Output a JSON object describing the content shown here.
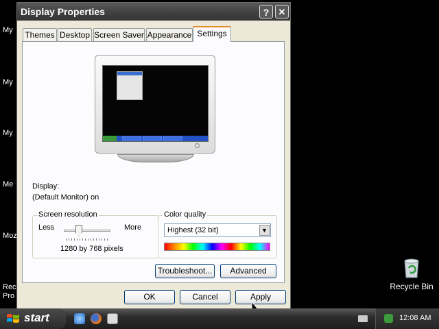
{
  "desktop": {
    "left_labels": [
      "My",
      "My",
      "My",
      "Me",
      "Moz",
      "Rec",
      "Pro"
    ],
    "recycle_bin_label": "Recycle Bin"
  },
  "window": {
    "title": "Display Properties",
    "help_label": "?",
    "close_label": "✕",
    "tabs": [
      {
        "label": "Themes"
      },
      {
        "label": "Desktop"
      },
      {
        "label": "Screen Saver"
      },
      {
        "label": "Appearance"
      },
      {
        "label": "Settings",
        "active": true
      }
    ],
    "settings": {
      "display_label": "Display:",
      "display_value": "(Default Monitor) on",
      "resolution": {
        "group_label": "Screen resolution",
        "less_label": "Less",
        "more_label": "More",
        "value_text": "1280 by 768 pixels",
        "slider_level": 0.3
      },
      "color_quality": {
        "group_label": "Color quality",
        "selected": "Highest (32 bit)",
        "arrow": "▼"
      },
      "troubleshoot_label": "Troubleshoot...",
      "advanced_label": "Advanced"
    },
    "buttons": {
      "ok_label": "OK",
      "cancel_label": "Cancel",
      "apply_label": "Apply"
    }
  },
  "taskbar": {
    "start_label": "start",
    "clock": "12:08 AM"
  },
  "colors": {
    "titlebar": "#3f3f3f",
    "dialog_bg": "#ece9d8",
    "active_tab_accent": "#e68b2c",
    "button_border": "#003c74"
  }
}
